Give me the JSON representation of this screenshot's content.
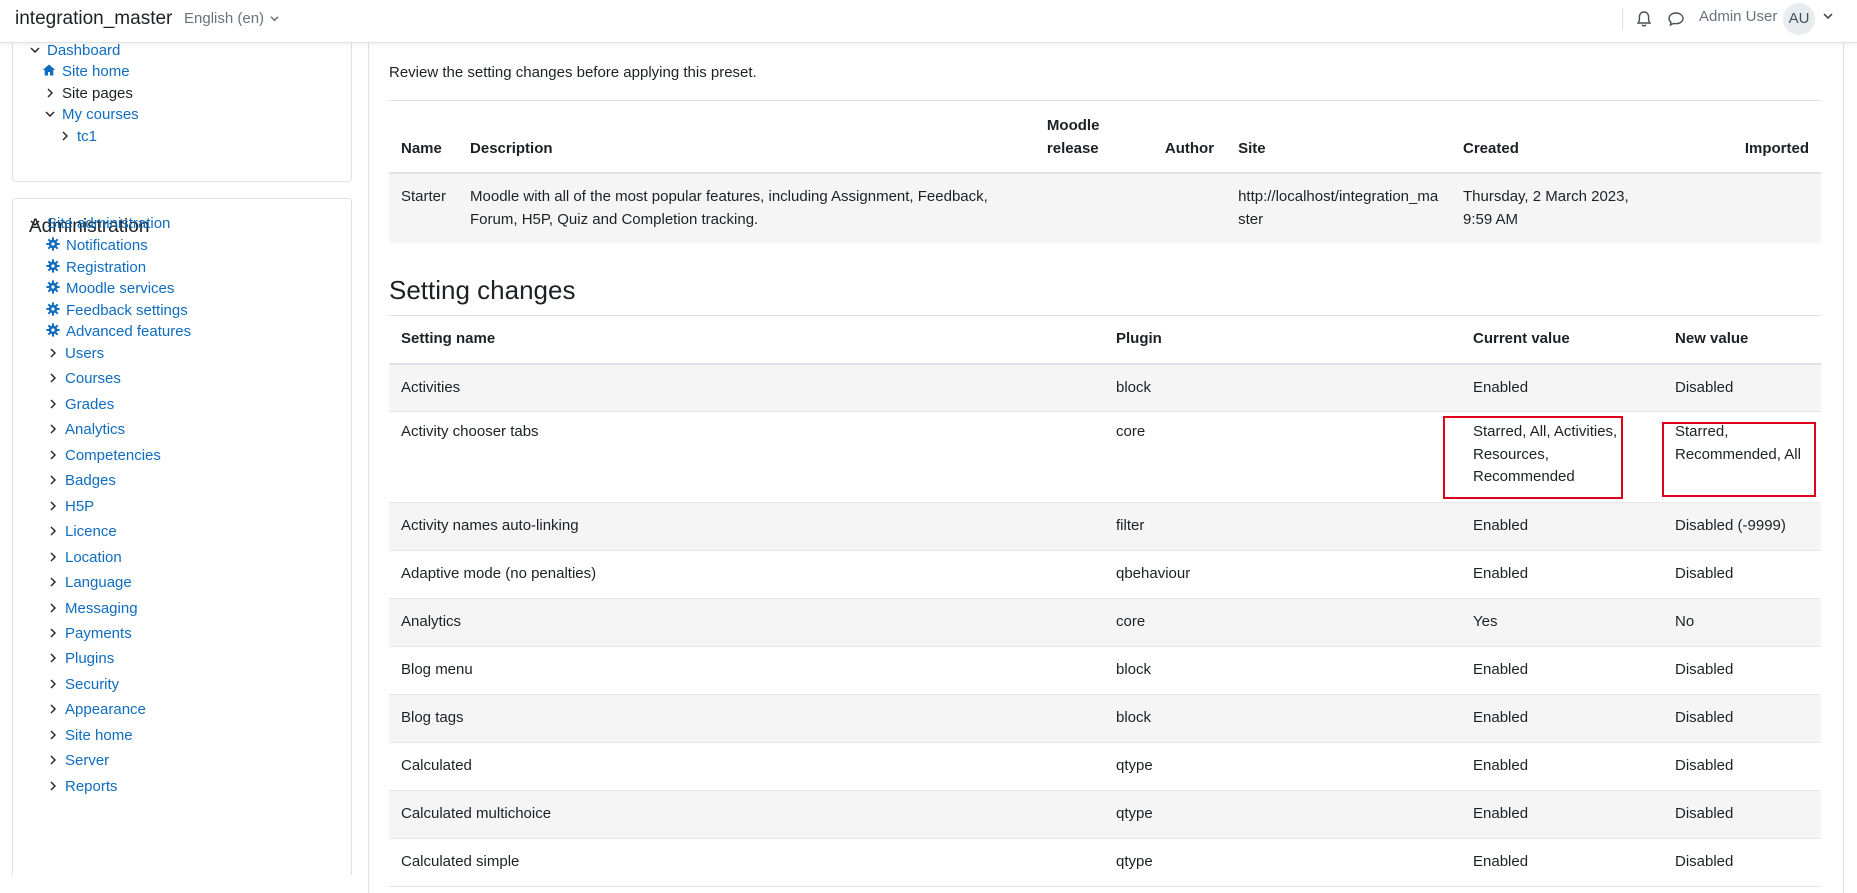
{
  "navbar": {
    "site_name": "integration_master",
    "language": "English (en)",
    "user_name": "Admin User",
    "avatar_initials": "AU"
  },
  "nav_block": {
    "items": [
      {
        "label": "Dashboard"
      },
      {
        "label": "Site home"
      },
      {
        "label": "Site pages"
      },
      {
        "label": "My courses"
      },
      {
        "label": "tc1"
      }
    ]
  },
  "admin_block": {
    "title": "Administration",
    "root": "Site administration",
    "settings": [
      "Notifications",
      "Registration",
      "Moodle services",
      "Feedback settings",
      "Advanced features"
    ],
    "categories": [
      "Users",
      "Courses",
      "Grades",
      "Analytics",
      "Competencies",
      "Badges",
      "H5P",
      "Licence",
      "Location",
      "Language",
      "Messaging",
      "Payments",
      "Plugins",
      "Security",
      "Appearance",
      "Site home",
      "Server",
      "Reports"
    ]
  },
  "main": {
    "intro": "Review the setting changes before applying this preset.",
    "preset_table": {
      "headers": {
        "name": "Name",
        "description": "Description",
        "moodle_release": "Moodle release",
        "author": "Author",
        "site": "Site",
        "created": "Created",
        "imported": "Imported"
      },
      "row": {
        "name": "Starter",
        "description": "Moodle with all of the most popular features, including Assignment, Feedback, Forum, H5P, Quiz and Completion tracking.",
        "moodle_release": "",
        "author": "",
        "site": "http://localhost/integration_master",
        "created": "Thursday, 2 March 2023, 9:59 AM",
        "imported": ""
      }
    },
    "changes_heading": "Setting changes",
    "changes_table": {
      "headers": {
        "setting": "Setting name",
        "plugin": "Plugin",
        "current": "Current value",
        "new": "New value"
      },
      "rows": [
        {
          "setting": "Activities",
          "plugin": "block",
          "current": "Enabled",
          "new": "Disabled"
        },
        {
          "setting": "Activity chooser tabs",
          "plugin": "core",
          "current": "Starred, All, Activities, Resources, Recommended",
          "new": "Starred, Recommended, All"
        },
        {
          "setting": "Activity names auto-linking",
          "plugin": "filter",
          "current": "Enabled",
          "new": "Disabled (-9999)"
        },
        {
          "setting": "Adaptive mode (no penalties)",
          "plugin": "qbehaviour",
          "current": "Enabled",
          "new": "Disabled"
        },
        {
          "setting": "Analytics",
          "plugin": "core",
          "current": "Yes",
          "new": "No"
        },
        {
          "setting": "Blog menu",
          "plugin": "block",
          "current": "Enabled",
          "new": "Disabled"
        },
        {
          "setting": "Blog tags",
          "plugin": "block",
          "current": "Enabled",
          "new": "Disabled"
        },
        {
          "setting": "Calculated",
          "plugin": "qtype",
          "current": "Enabled",
          "new": "Disabled"
        },
        {
          "setting": "Calculated multichoice",
          "plugin": "qtype",
          "current": "Enabled",
          "new": "Disabled"
        },
        {
          "setting": "Calculated simple",
          "plugin": "qtype",
          "current": "Enabled",
          "new": "Disabled"
        }
      ]
    }
  },
  "colors": {
    "link": "#0f6cbf",
    "highlight": "#e0001b",
    "stripe": "#f5f5f5"
  }
}
